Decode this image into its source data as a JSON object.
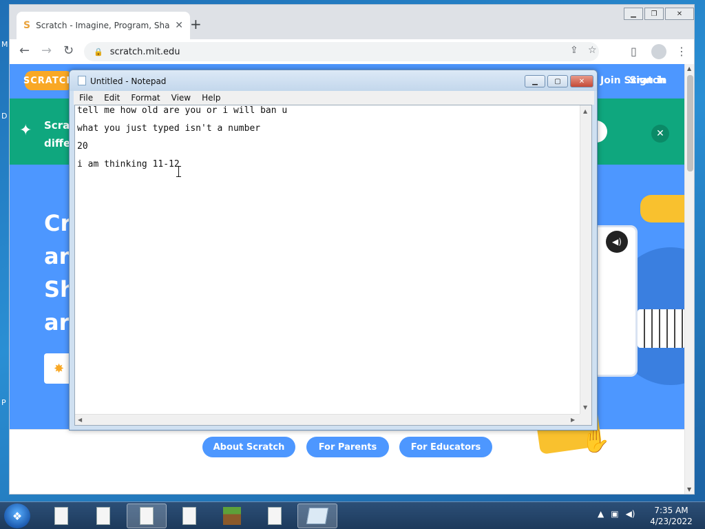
{
  "chrome": {
    "tab_title": "Scratch - Imagine, Program, Sha",
    "tab_favicon": "S",
    "url": "scratch.mit.edu",
    "new_tab": "+",
    "close_tab": "✕"
  },
  "scratch": {
    "logo": "SCRATCH",
    "nav_join": "Join Scratch",
    "nav_signin": "Sign in",
    "banner_line1": "Scrat",
    "banner_line2": "differ",
    "banner_close": "✕",
    "hero_lines": [
      "Cre",
      "an",
      "Sh",
      "arc"
    ],
    "footer_links": [
      "About Scratch",
      "For Parents",
      "For Educators"
    ]
  },
  "notepad": {
    "title": "Untitled - Notepad",
    "menu": [
      "File",
      "Edit",
      "Format",
      "View",
      "Help"
    ],
    "lines": [
      "tell me how old are you or i will ban u",
      "what you just typed isn't a number",
      "20",
      "i am thinking 11-12"
    ]
  },
  "desktop": {
    "edge_letters": [
      "M",
      "D",
      "P"
    ]
  },
  "taskbar": {
    "time": "7:35 AM",
    "date": "4/23/2022"
  }
}
